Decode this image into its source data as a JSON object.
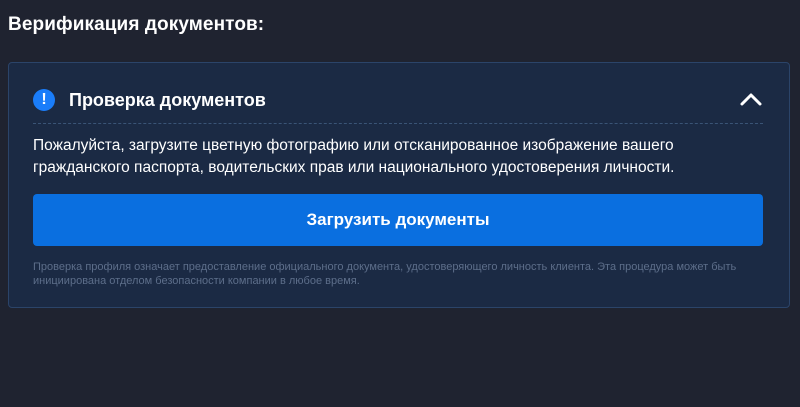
{
  "section": {
    "title": "Верификация документов:"
  },
  "panel": {
    "icon": "info-icon",
    "heading": "Проверка документов",
    "toggle_icon": "chevron-up-icon",
    "description": "Пожалуйста, загрузите цветную фотографию или отсканированное изображение вашего гражданского паспорта, водительских прав или национального удостоверения личности.",
    "upload_button_label": "Загрузить документы",
    "footnote": "Проверка профиля означает предоставление официального документа, удостоверяющего личность клиента. Эта процедура может быть инициирована отделом безопасности компании в любое время."
  },
  "colors": {
    "page_background": "#1f2330",
    "panel_background": "#1b2a44",
    "accent": "#0a6fe0",
    "info_icon": "#1a7dfa"
  }
}
